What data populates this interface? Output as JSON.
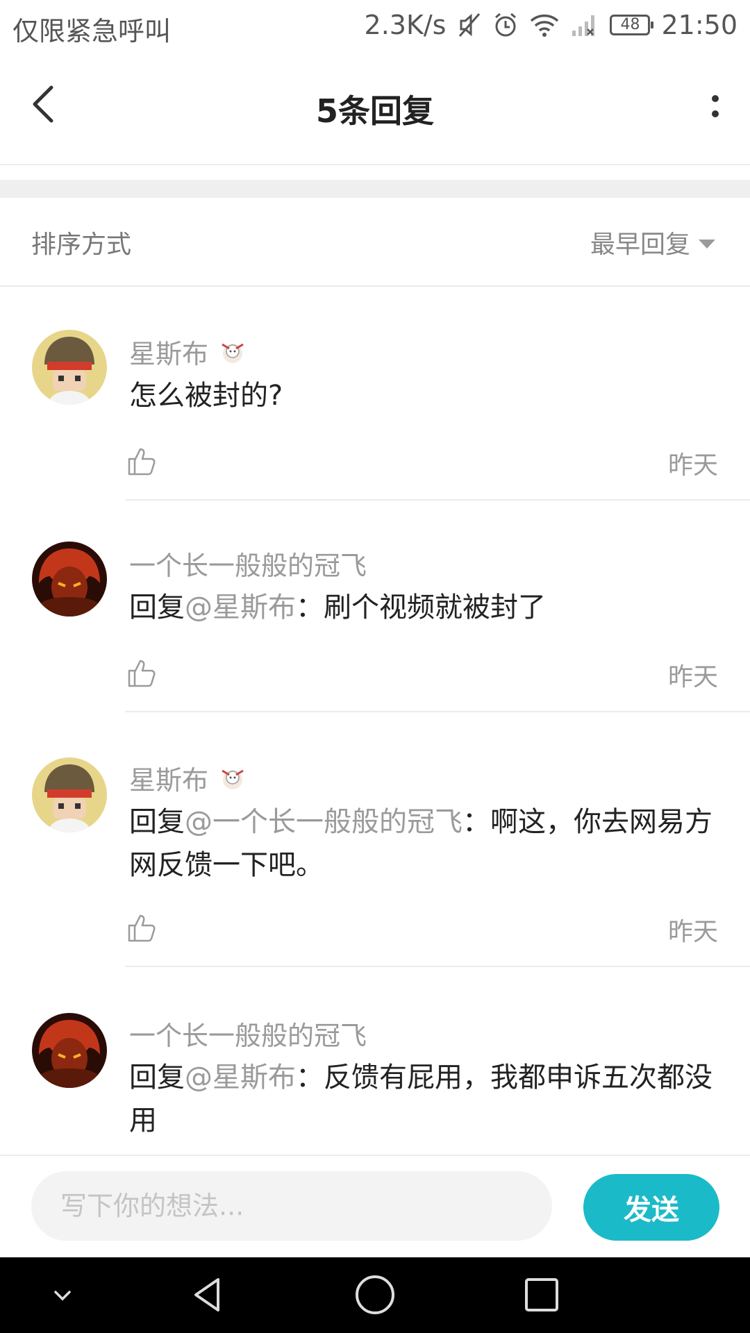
{
  "status_bar": {
    "left_text": "仅限紧急呼叫",
    "speed": "2.3K/s",
    "battery": "48",
    "time": "21:50"
  },
  "header": {
    "title": "5条回复"
  },
  "sort": {
    "label": "排序方式",
    "value": "最早回复"
  },
  "comments": [
    {
      "author": "星斯布",
      "has_badge": true,
      "reply_prefix": "",
      "mention": "",
      "text": "怎么被封的?",
      "time": "昨天"
    },
    {
      "author": "一个长一般般的冠飞",
      "has_badge": false,
      "reply_prefix": "回复",
      "mention": "@星斯布",
      "text": "：刷个视频就被封了",
      "time": "昨天"
    },
    {
      "author": "星斯布",
      "has_badge": true,
      "reply_prefix": "回复",
      "mention": "@一个长一般般的冠飞",
      "text": "：啊这，你去网易方网反馈一下吧。",
      "time": "昨天"
    },
    {
      "author": "一个长一般般的冠飞",
      "has_badge": false,
      "reply_prefix": "回复",
      "mention": "@星斯布",
      "text": "：反馈有屁用，我都申诉五次都没用",
      "time": ""
    }
  ],
  "input": {
    "placeholder": "写下你的想法..."
  },
  "send_label": "发送",
  "colors": {
    "accent": "#1bbac8",
    "muted_text": "#9a9a9a",
    "divider": "#ececec"
  }
}
